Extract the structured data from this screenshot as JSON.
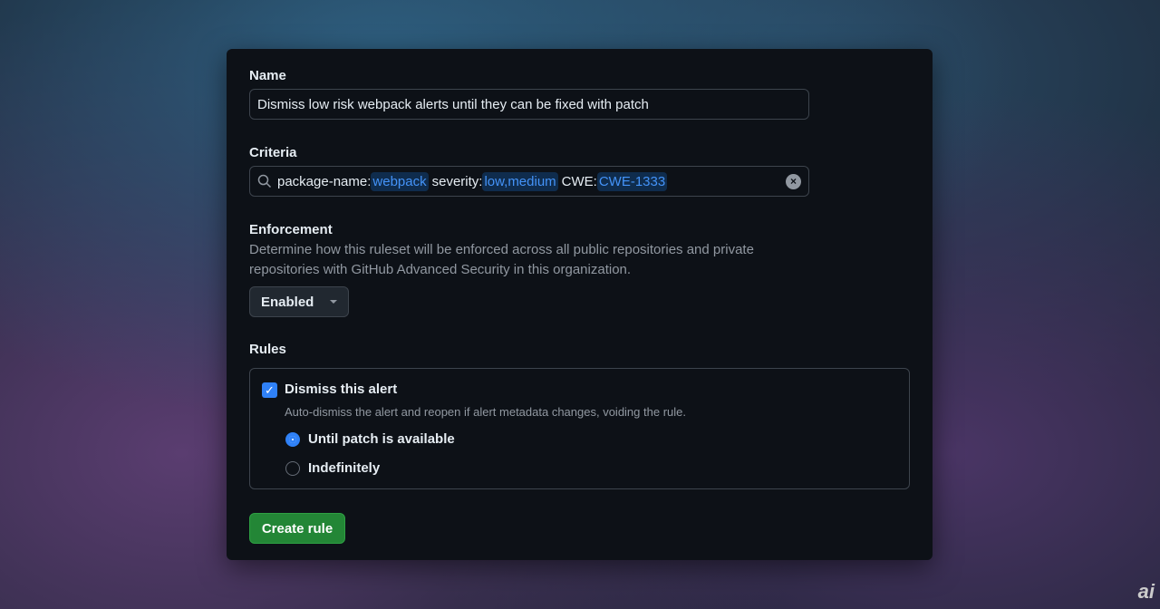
{
  "name": {
    "label": "Name",
    "value": "Dismiss low risk webpack alerts until they can be fixed with patch"
  },
  "criteria": {
    "label": "Criteria",
    "tokens": [
      {
        "key": "package-name:",
        "value": "webpack"
      },
      {
        "key": "severity:",
        "value": "low,medium"
      },
      {
        "key": "CWE:",
        "value": "CWE-1333"
      }
    ]
  },
  "enforcement": {
    "label": "Enforcement",
    "description": "Determine how this ruleset will be enforced across all public repositories and private repositories with GitHub Advanced Security in this organization.",
    "selected": "Enabled"
  },
  "rules": {
    "label": "Rules",
    "checkbox_label": "Dismiss this alert",
    "checked": true,
    "description": "Auto-dismiss the alert and reopen if alert metadata changes, voiding the rule.",
    "options": [
      {
        "label": "Until patch is available",
        "selected": true
      },
      {
        "label": "Indefinitely",
        "selected": false
      }
    ]
  },
  "submit": "Create rule",
  "watermark": "ai",
  "colors": {
    "accent": "#2f81f7",
    "primary_button": "#238636"
  }
}
